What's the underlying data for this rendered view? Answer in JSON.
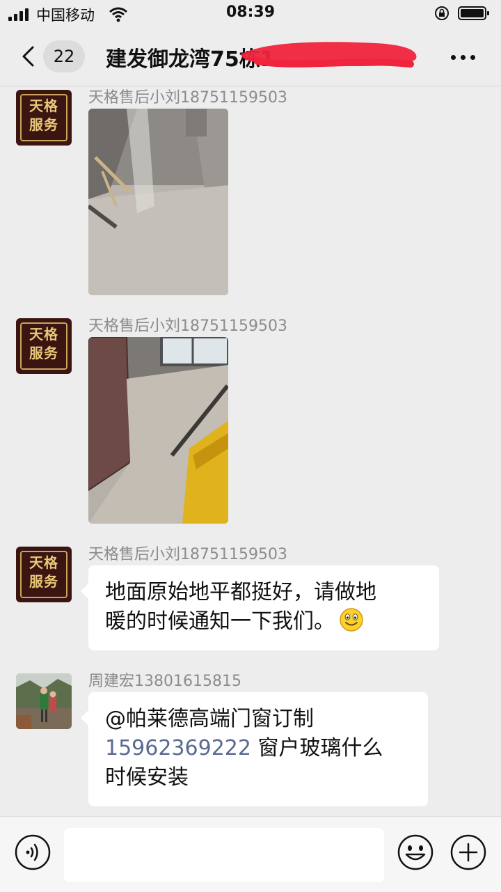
{
  "status_bar": {
    "carrier": "中国移动",
    "time": "08:39"
  },
  "nav": {
    "unread_count": "22",
    "title": "建发御龙湾75栋1"
  },
  "messages": [
    {
      "sender": "天格售后小刘18751159503",
      "avatar_text": [
        "天格",
        "服务"
      ],
      "type": "image"
    },
    {
      "sender": "天格售后小刘18751159503",
      "avatar_text": [
        "天格",
        "服务"
      ],
      "type": "image"
    },
    {
      "sender": "天格售后小刘18751159503",
      "avatar_text": [
        "天格",
        "服务"
      ],
      "type": "text",
      "lines": [
        "地面原始地平都挺好，请做地",
        "暖的时候通知一下我们。"
      ],
      "emoji": "smile-emoji"
    },
    {
      "sender": "周建宏13801615815",
      "type": "text",
      "line1": "@帕莱德高端门窗订制",
      "phone": "15962369222",
      "line2_rest": " 窗户玻璃什么",
      "line3": "时候安装"
    }
  ],
  "colors": {
    "background": "#ededed",
    "bubble": "#ffffff",
    "sender_name": "#8c8c8c",
    "link": "#5b6a92",
    "avatar_brand_bg": "#3a1512",
    "avatar_brand_text": "#e9c878",
    "redaction": "#f0243d"
  }
}
